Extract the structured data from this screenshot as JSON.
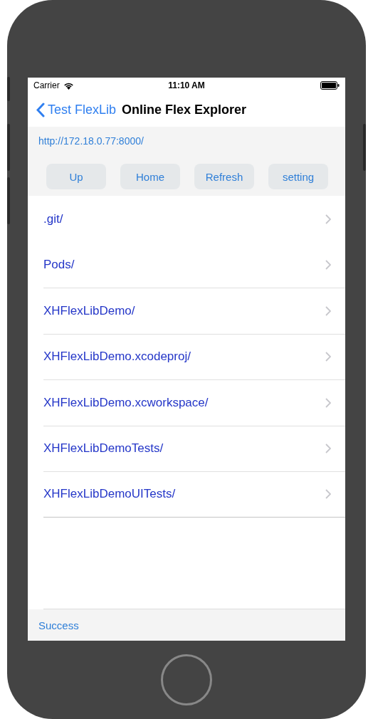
{
  "status_bar": {
    "carrier": "Carrier",
    "time": "11:10 AM"
  },
  "nav_bar": {
    "back_label": "Test FlexLib",
    "title": "Online Flex Explorer"
  },
  "address": "http://172.18.0.77:8000/",
  "buttons": [
    "Up",
    "Home",
    "Refresh",
    "setting"
  ],
  "items": [
    {
      "label": ".git/"
    },
    {
      "label": "Pods/"
    },
    {
      "label": "XHFlexLibDemo/"
    },
    {
      "label": "XHFlexLibDemo.xcodeproj/"
    },
    {
      "label": "XHFlexLibDemo.xcworkspace/"
    },
    {
      "label": "XHFlexLibDemoTests/"
    },
    {
      "label": "XHFlexLibDemoUITests/"
    }
  ],
  "footer": "Success"
}
